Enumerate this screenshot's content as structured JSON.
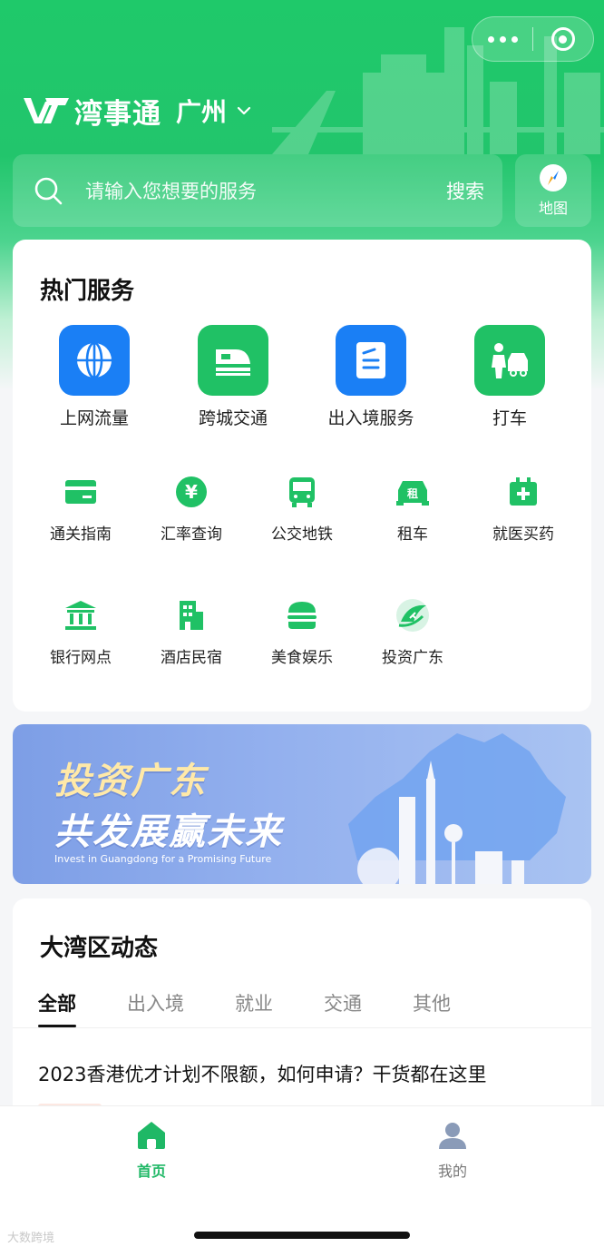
{
  "header": {
    "app_name": "湾事通",
    "city": "广州",
    "capsule_icons": [
      "more-dots-icon",
      "close-circle-icon"
    ]
  },
  "search": {
    "placeholder": "请输入您想要的服务",
    "button_label": "搜索",
    "map_label": "地图"
  },
  "hot_services": {
    "title": "热门服务",
    "featured": [
      {
        "label": "上网流量",
        "icon": "globe-icon",
        "color": "#1a7ff5"
      },
      {
        "label": "跨城交通",
        "icon": "train-icon",
        "color": "#20c165"
      },
      {
        "label": "出入境服务",
        "icon": "passport-icon",
        "color": "#1a7ff5"
      },
      {
        "label": "打车",
        "icon": "taxi-icon",
        "color": "#20c165"
      }
    ],
    "items": [
      {
        "label": "通关指南",
        "icon": "card-icon"
      },
      {
        "label": "汇率查询",
        "icon": "yen-icon"
      },
      {
        "label": "公交地铁",
        "icon": "bus-icon"
      },
      {
        "label": "租车",
        "icon": "rental-car-icon"
      },
      {
        "label": "就医买药",
        "icon": "medical-kit-icon"
      },
      {
        "label": "银行网点",
        "icon": "bank-icon"
      },
      {
        "label": "酒店民宿",
        "icon": "hotel-icon"
      },
      {
        "label": "美食娱乐",
        "icon": "burger-icon"
      },
      {
        "label": "投资广东",
        "icon": "invest-logo-icon"
      }
    ]
  },
  "banner": {
    "line1": "投资广东",
    "line2": "共发展赢未来",
    "subtitle": "Invest in Guangdong for a Promising Future"
  },
  "news": {
    "title": "大湾区动态",
    "tabs": [
      "全部",
      "出入境",
      "就业",
      "交通",
      "其他"
    ],
    "active_tab": "全部",
    "articles": [
      {
        "title": "2023香港优才计划不限额，如何申请？干货都在这里"
      }
    ]
  },
  "tabbar": {
    "items": [
      {
        "label": "首页",
        "icon": "home-icon",
        "active": true
      },
      {
        "label": "我的",
        "icon": "user-icon",
        "active": false
      }
    ]
  },
  "watermark": "大数跨境",
  "colors": {
    "brand_green": "#20c165",
    "accent_blue": "#1a7ff5",
    "active_tab_label": "#1fb866"
  }
}
